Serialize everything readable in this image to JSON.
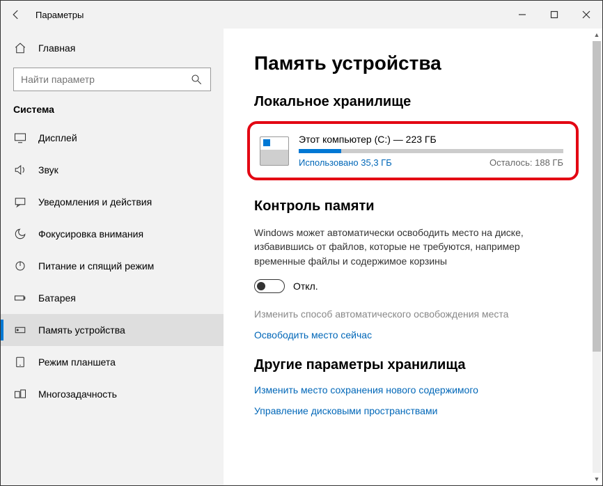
{
  "window": {
    "title": "Параметры"
  },
  "sidebar": {
    "home": "Главная",
    "search_placeholder": "Найти параметр",
    "category": "Система",
    "items": [
      {
        "label": "Дисплей"
      },
      {
        "label": "Звук"
      },
      {
        "label": "Уведомления и действия"
      },
      {
        "label": "Фокусировка внимания"
      },
      {
        "label": "Питание и спящий режим"
      },
      {
        "label": "Батарея"
      },
      {
        "label": "Память устройства"
      },
      {
        "label": "Режим планшета"
      },
      {
        "label": "Многозадачность"
      }
    ]
  },
  "main": {
    "title": "Память устройства",
    "local_storage_heading": "Локальное хранилище",
    "drive": {
      "name": "Этот компьютер (C:) — 223 ГБ",
      "used_label": "Использовано 35,3 ГБ",
      "remaining_label": "Осталось: 188 ГБ"
    },
    "sense": {
      "heading": "Контроль памяти",
      "description": "Windows может автоматически освободить место на диске, избавившись от файлов, которые не требуются, например временные файлы и содержимое корзины",
      "toggle_label": "Откл.",
      "change_link": "Изменить способ автоматического освобождения места",
      "free_now_link": "Освободить место сейчас"
    },
    "other": {
      "heading": "Другие параметры хранилища",
      "change_save_link": "Изменить место сохранения нового содержимого",
      "manage_spaces_link": "Управление дисковыми пространствами"
    }
  }
}
